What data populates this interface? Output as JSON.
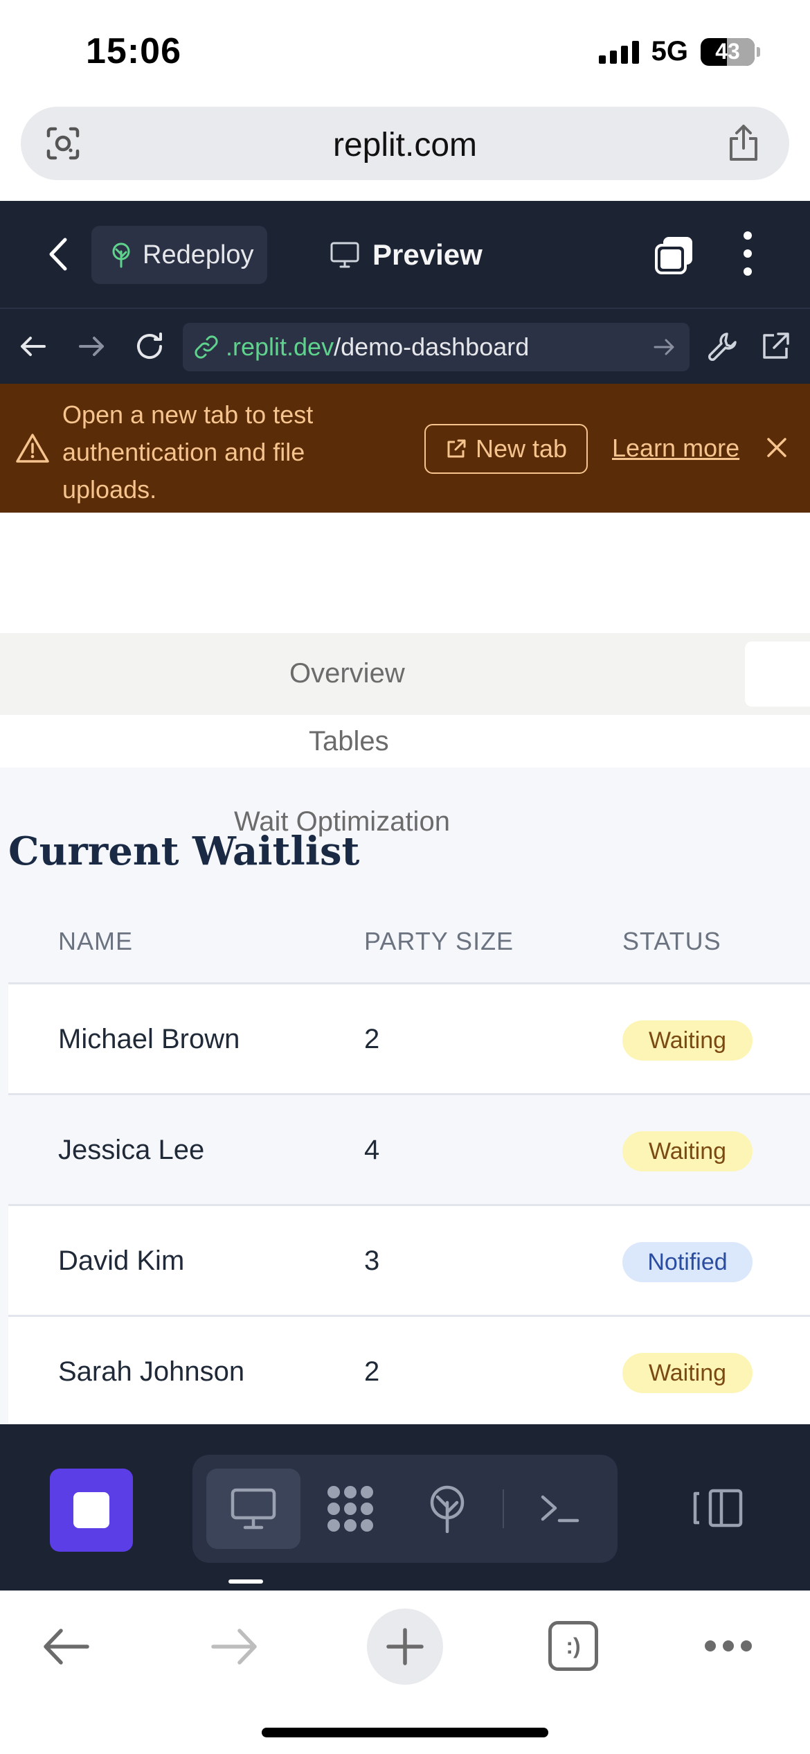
{
  "status_bar": {
    "time": "15:06",
    "network": "5G",
    "battery": "43"
  },
  "browser": {
    "url": "replit.com"
  },
  "replit_header": {
    "redeploy_label": "Redeploy",
    "preview_label": "Preview"
  },
  "webview": {
    "url_domain": ".replit.dev",
    "url_path": "/demo-dashboard"
  },
  "banner": {
    "message": "Open a new tab to test authentication and file uploads.",
    "new_tab_label": "New tab",
    "learn_more_label": "Learn more"
  },
  "nav": {
    "overview": "Overview",
    "tables": "Tables",
    "wait_optimization": "Wait Optimization"
  },
  "waitlist": {
    "title": "Current Waitlist",
    "columns": [
      "NAME",
      "PARTY SIZE",
      "STATUS"
    ],
    "rows": [
      {
        "name": "Michael Brown",
        "party_size": "2",
        "status": "Waiting"
      },
      {
        "name": "Jessica Lee",
        "party_size": "4",
        "status": "Waiting"
      },
      {
        "name": "David Kim",
        "party_size": "3",
        "status": "Notified"
      },
      {
        "name": "Sarah Johnson",
        "party_size": "2",
        "status": "Waiting"
      }
    ]
  },
  "bottom_toolbar": {
    "tabs_count_label": ":)"
  },
  "colors": {
    "replit_dark": "#1c2333",
    "banner_bg": "#5a2c08",
    "banner_text": "#f6c48e",
    "stop_purple": "#5b3ee6",
    "waiting_badge": "#fdf5b5",
    "notified_badge": "#dbe7fb",
    "link_green": "#5fd38d"
  },
  "icons": {
    "url_left": "camera-lens-icon",
    "url_right": "share-icon",
    "back": "chevron-left-icon",
    "redeploy": "deploy-tree-icon",
    "preview": "monitor-icon",
    "tabs": "tabs-icon",
    "menu": "kebab-menu-icon",
    "warning": "warning-triangle-icon",
    "external": "external-link-icon",
    "close": "close-icon",
    "stop": "stop-icon",
    "tools": [
      "monitor-icon",
      "apps-grid-icon",
      "deploy-icon",
      "terminal-icon"
    ],
    "panel": "panel-toggle-icon"
  }
}
